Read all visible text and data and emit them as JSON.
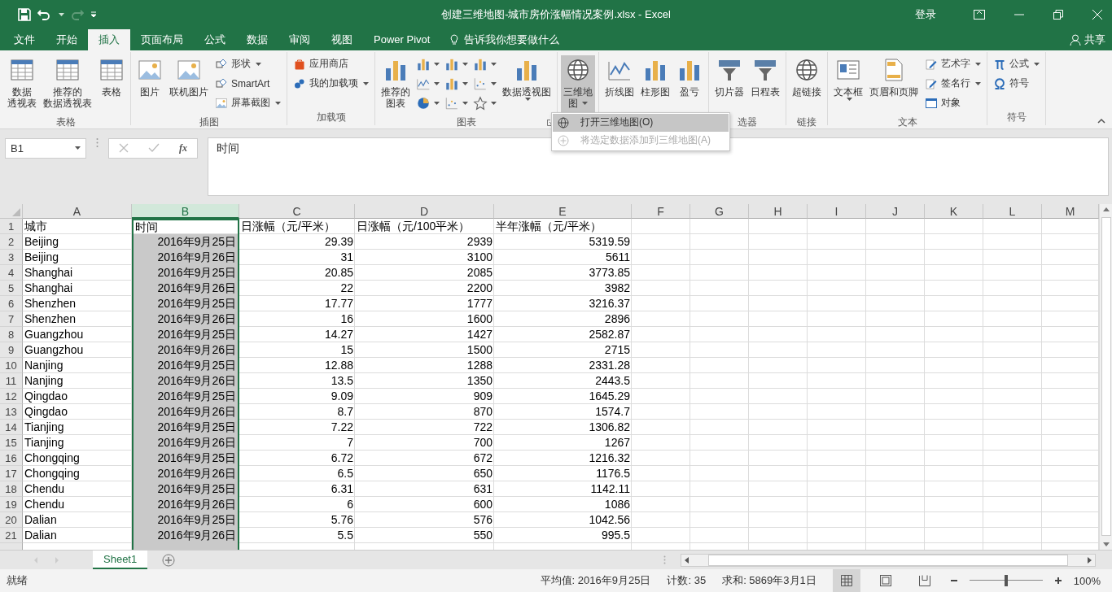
{
  "window": {
    "title": "创建三维地图-城市房价涨幅情况案例.xlsx  -  Excel",
    "sign_in": "登录"
  },
  "tabs": [
    {
      "label": "文件",
      "selected": false
    },
    {
      "label": "开始",
      "selected": false
    },
    {
      "label": "插入",
      "selected": true
    },
    {
      "label": "页面布局",
      "selected": false
    },
    {
      "label": "公式",
      "selected": false
    },
    {
      "label": "数据",
      "selected": false
    },
    {
      "label": "审阅",
      "selected": false
    },
    {
      "label": "视图",
      "selected": false
    },
    {
      "label": "Power Pivot",
      "selected": false
    }
  ],
  "tell_me": {
    "placeholder": "告诉我你想要做什么"
  },
  "share": "共享",
  "ribbon": [
    {
      "label": "表格",
      "columns": [
        [
          {
            "kind": "large",
            "lines": [
              "数据",
              "透视表"
            ]
          }
        ],
        [
          {
            "kind": "large",
            "lines": [
              "推荐的",
              "数据透视表"
            ]
          }
        ],
        [
          {
            "kind": "large",
            "lines": [
              "表格"
            ]
          }
        ]
      ]
    },
    {
      "label": "插图",
      "columns": [
        [
          {
            "kind": "large",
            "lines": [
              "图片"
            ]
          }
        ],
        [
          {
            "kind": "large",
            "lines": [
              "联机图片"
            ]
          }
        ],
        [
          {
            "kind": "small",
            "label": "形状",
            "dropdown": true
          },
          {
            "kind": "small",
            "label": "SmartArt",
            "dropdown": false
          },
          {
            "kind": "small",
            "label": "屏幕截图",
            "dropdown": true
          }
        ]
      ]
    },
    {
      "label": "加载项",
      "columns": [
        [
          {
            "kind": "small",
            "label": "应用商店",
            "dropdown": false
          },
          {
            "kind": "small",
            "label": "我的加载项",
            "dropdown": true
          }
        ]
      ]
    },
    {
      "label": "图表",
      "launcher": true,
      "columns": [
        [
          {
            "kind": "large",
            "lines": [
              "推荐的",
              "图表"
            ]
          }
        ],
        [
          {
            "kind": "chart",
            "dropdown": true
          },
          {
            "kind": "chart",
            "dropdown": true
          },
          {
            "kind": "chart",
            "dropdown": true
          }
        ],
        [
          {
            "kind": "chart",
            "dropdown": true
          },
          {
            "kind": "chart",
            "dropdown": true
          },
          {
            "kind": "chart",
            "dropdown": true
          }
        ],
        [
          {
            "kind": "chart",
            "dropdown": true
          },
          {
            "kind": "chart",
            "dropdown": true
          },
          {
            "kind": "chart",
            "dropdown": true
          }
        ],
        [
          {
            "kind": "large",
            "lines": [
              "数据透视图"
            ],
            "dropdown": true
          }
        ]
      ]
    },
    {
      "columns": [
        [
          {
            "kind": "large",
            "lines": [
              "三维地",
              "图"
            ],
            "dropdown": true,
            "expanded": true
          }
        ]
      ]
    },
    {
      "columns": [
        [
          {
            "kind": "large",
            "lines": [
              "折线图"
            ]
          }
        ],
        [
          {
            "kind": "large",
            "lines": [
              "柱形图"
            ]
          }
        ],
        [
          {
            "kind": "large",
            "lines": [
              "盈亏"
            ]
          }
        ]
      ]
    },
    {
      "label": "选器",
      "columns": [
        [
          {
            "kind": "large",
            "lines": [
              "切片器"
            ]
          }
        ],
        [
          {
            "kind": "large",
            "lines": [
              "日程表"
            ]
          }
        ]
      ]
    },
    {
      "label": "链接",
      "columns": [
        [
          {
            "kind": "large",
            "lines": [
              "超链接"
            ]
          }
        ]
      ]
    },
    {
      "label": "文本",
      "columns": [
        [
          {
            "kind": "large",
            "lines": [
              "文本框"
            ],
            "dropdown": true
          }
        ],
        [
          {
            "kind": "large",
            "lines": [
              "页眉和页脚"
            ]
          }
        ],
        [
          {
            "kind": "small",
            "label": "艺术字",
            "dropdown": true
          },
          {
            "kind": "small",
            "label": "签名行",
            "dropdown": true
          },
          {
            "kind": "small",
            "label": "对象",
            "dropdown": false
          }
        ]
      ]
    },
    {
      "label": "符号",
      "columns": [
        [
          {
            "kind": "small",
            "label": "公式",
            "dropdown": true
          },
          {
            "kind": "small",
            "label": "符号",
            "dropdown": false
          }
        ]
      ]
    }
  ],
  "menu": [
    {
      "label": "打开三维地图(O)",
      "selected": true,
      "disabled": false
    },
    {
      "label": "将选定数据添加到三维地图(A)",
      "selected": false,
      "disabled": true
    }
  ],
  "name_box": "B1",
  "fx": "fx",
  "formula": "时间",
  "columns": [
    {
      "label": "A",
      "selected": false
    },
    {
      "label": "B",
      "selected": true
    },
    {
      "label": "C",
      "selected": false
    },
    {
      "label": "D",
      "selected": false
    },
    {
      "label": "E",
      "selected": false
    },
    {
      "label": "F",
      "selected": false
    },
    {
      "label": "G",
      "selected": false
    },
    {
      "label": "H",
      "selected": false
    },
    {
      "label": "I",
      "selected": false
    },
    {
      "label": "J",
      "selected": false
    },
    {
      "label": "K",
      "selected": false
    },
    {
      "label": "L",
      "selected": false
    },
    {
      "label": "M",
      "selected": false
    }
  ],
  "rows": [
    {
      "number": "1",
      "kind": "header",
      "cells": [
        "城市",
        "时间",
        "日涨幅（元/平米）",
        "日涨幅（元/100平米）",
        "半年涨幅（元/平米）"
      ]
    },
    {
      "number": "2",
      "kind": "data",
      "cells": [
        "Beijing",
        "2016年9月25日",
        "29.39",
        "2939",
        "5319.59"
      ]
    },
    {
      "number": "3",
      "kind": "data",
      "cells": [
        "Beijing",
        "2016年9月26日",
        "31",
        "3100",
        "5611"
      ]
    },
    {
      "number": "4",
      "kind": "data",
      "cells": [
        "Shanghai",
        "2016年9月25日",
        "20.85",
        "2085",
        "3773.85"
      ]
    },
    {
      "number": "5",
      "kind": "data",
      "cells": [
        "Shanghai",
        "2016年9月26日",
        "22",
        "2200",
        "3982"
      ]
    },
    {
      "number": "6",
      "kind": "data",
      "cells": [
        "Shenzhen",
        "2016年9月25日",
        "17.77",
        "1777",
        "3216.37"
      ]
    },
    {
      "number": "7",
      "kind": "data",
      "cells": [
        "Shenzhen",
        "2016年9月26日",
        "16",
        "1600",
        "2896"
      ]
    },
    {
      "number": "8",
      "kind": "data",
      "cells": [
        "Guangzhou",
        "2016年9月25日",
        "14.27",
        "1427",
        "2582.87"
      ]
    },
    {
      "number": "9",
      "kind": "data",
      "cells": [
        "Guangzhou",
        "2016年9月26日",
        "15",
        "1500",
        "2715"
      ]
    },
    {
      "number": "10",
      "kind": "data",
      "cells": [
        "Nanjing",
        "2016年9月25日",
        "12.88",
        "1288",
        "2331.28"
      ]
    },
    {
      "number": "11",
      "kind": "data",
      "cells": [
        "Nanjing",
        "2016年9月26日",
        "13.5",
        "1350",
        "2443.5"
      ]
    },
    {
      "number": "12",
      "kind": "data",
      "cells": [
        "Qingdao",
        "2016年9月25日",
        "9.09",
        "909",
        "1645.29"
      ]
    },
    {
      "number": "13",
      "kind": "data",
      "cells": [
        "Qingdao",
        "2016年9月26日",
        "8.7",
        "870",
        "1574.7"
      ]
    },
    {
      "number": "14",
      "kind": "data",
      "cells": [
        "Tianjing",
        "2016年9月25日",
        "7.22",
        "722",
        "1306.82"
      ]
    },
    {
      "number": "15",
      "kind": "data",
      "cells": [
        "Tianjing",
        "2016年9月26日",
        "7",
        "700",
        "1267"
      ]
    },
    {
      "number": "16",
      "kind": "data",
      "cells": [
        "Chongqing",
        "2016年9月25日",
        "6.72",
        "672",
        "1216.32"
      ]
    },
    {
      "number": "17",
      "kind": "data",
      "cells": [
        "Chongqing",
        "2016年9月26日",
        "6.5",
        "650",
        "1176.5"
      ]
    },
    {
      "number": "18",
      "kind": "data",
      "cells": [
        "Chendu",
        "2016年9月25日",
        "6.31",
        "631",
        "1142.11"
      ]
    },
    {
      "number": "19",
      "kind": "data",
      "cells": [
        "Chendu",
        "2016年9月26日",
        "6",
        "600",
        "1086"
      ]
    },
    {
      "number": "20",
      "kind": "data",
      "cells": [
        "Dalian",
        "2016年9月25日",
        "5.76",
        "576",
        "1042.56"
      ]
    },
    {
      "number": "21",
      "kind": "data",
      "cells": [
        "Dalian",
        "2016年9月26日",
        "5.5",
        "550",
        "995.5"
      ]
    }
  ],
  "sheets": [
    {
      "label": "Sheet1",
      "selected": true
    }
  ],
  "status_bar": {
    "status": "就绪",
    "stats": [
      "平均值: 2016年9月25日",
      "计数: 35",
      "求和: 5869年3月1日"
    ],
    "views": [
      {
        "selected": true
      },
      {
        "selected": false
      },
      {
        "selected": false
      }
    ],
    "zoom": {
      "level": 0.5,
      "reading": "100%"
    }
  }
}
